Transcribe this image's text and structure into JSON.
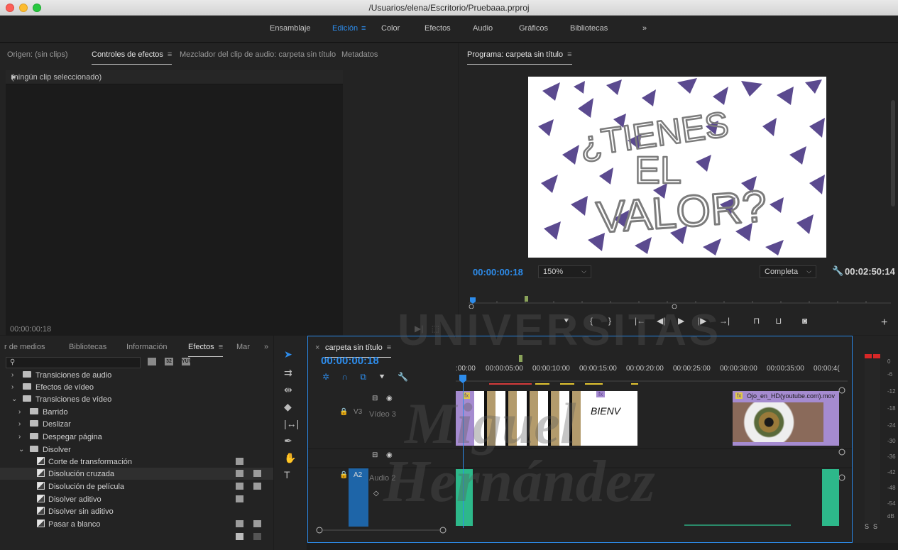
{
  "window": {
    "title": "/Usuarios/elena/Escritorio/Pruebaaa.prproj"
  },
  "workspaces": {
    "items": [
      "Ensamblaje",
      "Edición",
      "Color",
      "Efectos",
      "Audio",
      "Gráficos",
      "Bibliotecas"
    ],
    "active": "Edición",
    "overflow": "»"
  },
  "source_panel": {
    "tabs": [
      "Origen: (sin clips)",
      "Controles de efectos",
      "Mezclador del clip de audio: carpeta sin título",
      "Metadatos"
    ],
    "active_tab": "Controles de efectos",
    "header": "(ningún clip seleccionado)",
    "timecode": "00:00:00:18"
  },
  "program_monitor": {
    "title": "Programa: carpeta sin título",
    "timecode": "00:00:00:18",
    "zoom": "150%",
    "resolution": "Completa",
    "duration": "00:02:50:14",
    "frame_lines": [
      "¿TIENES",
      "EL",
      "VALOR?"
    ],
    "accent": "#5b4a8f"
  },
  "effects_panel": {
    "tabs": [
      "r de medios",
      "Bibliotecas",
      "Información",
      "Efectos",
      "Mar"
    ],
    "active_tab": "Efectos",
    "overflow": "»",
    "search_placeholder": "",
    "badges": [
      "32",
      "YUV"
    ],
    "tree": [
      {
        "label": "Transiciones de audio",
        "type": "folder",
        "level": 0,
        "expanded": false
      },
      {
        "label": "Efectos de vídeo",
        "type": "folder",
        "level": 0,
        "expanded": false
      },
      {
        "label": "Transiciones de vídeo",
        "type": "folder",
        "level": 0,
        "expanded": true
      },
      {
        "label": "Barrido",
        "type": "folder",
        "level": 1,
        "expanded": false
      },
      {
        "label": "Deslizar",
        "type": "folder",
        "level": 1,
        "expanded": false
      },
      {
        "label": "Despegar página",
        "type": "folder",
        "level": 1,
        "expanded": false
      },
      {
        "label": "Disolver",
        "type": "folder",
        "level": 1,
        "expanded": true
      },
      {
        "label": "Corte de transformación",
        "type": "effect",
        "level": 2,
        "badges": 1
      },
      {
        "label": "Disolución cruzada",
        "type": "effect",
        "level": 2,
        "badges": 2,
        "selected": true
      },
      {
        "label": "Disolución de película",
        "type": "effect",
        "level": 2,
        "badges": 2
      },
      {
        "label": "Disolver aditivo",
        "type": "effect",
        "level": 2,
        "badges": 1
      },
      {
        "label": "Disolver sin aditivo",
        "type": "effect",
        "level": 2,
        "badges": 0
      },
      {
        "label": "Pasar a blanco",
        "type": "effect",
        "level": 2,
        "badges": 2
      }
    ]
  },
  "timeline": {
    "sequence_name": "carpeta sin título",
    "timecode": "00:00:00:18",
    "ruler": [
      ":00:00",
      "00:00:05:00",
      "00:00:10:00",
      "00:00:15:00",
      "00:00:20:00",
      "00:00:25:00",
      "00:00:30:00",
      "00:00:35:00",
      "00:00:4("
    ],
    "tracks": {
      "v3": {
        "id": "V3",
        "name": "Vídeo 3"
      },
      "a2": {
        "id": "A2",
        "name": "Audio 2"
      }
    },
    "clips": {
      "title_text": "BIENV",
      "mov_name": "Ojo_en_HD(youtube.com).mov",
      "fx_label": "fx"
    }
  },
  "audio_meter": {
    "scale": [
      "0",
      "-6",
      "-12",
      "-18",
      "-24",
      "-30",
      "-36",
      "-42",
      "-48",
      "-54",
      "dB"
    ],
    "solo": [
      "S",
      "S"
    ]
  },
  "watermark": {
    "lines": [
      "UNIVERSITAS",
      "Miguel",
      "Hernández"
    ]
  }
}
